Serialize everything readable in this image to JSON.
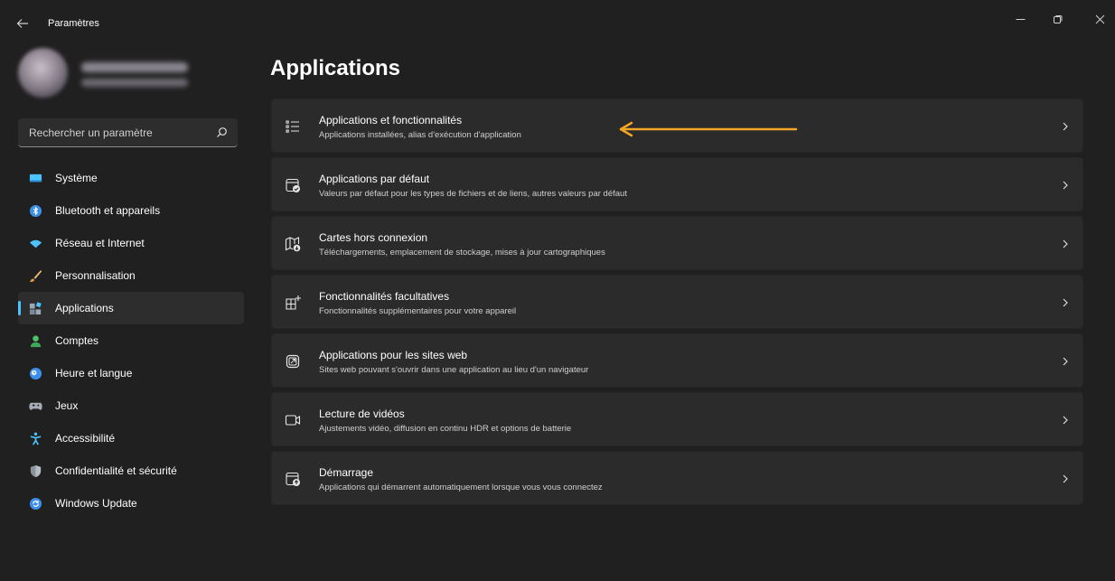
{
  "window": {
    "title": "Paramètres"
  },
  "search": {
    "placeholder": "Rechercher un paramètre"
  },
  "sidebar": {
    "items": [
      {
        "label": "Système",
        "icon": "monitor-icon"
      },
      {
        "label": "Bluetooth et appareils",
        "icon": "bluetooth-icon"
      },
      {
        "label": "Réseau et Internet",
        "icon": "wifi-icon"
      },
      {
        "label": "Personnalisation",
        "icon": "brush-icon"
      },
      {
        "label": "Applications",
        "icon": "apps-icon",
        "active": true
      },
      {
        "label": "Comptes",
        "icon": "person-icon"
      },
      {
        "label": "Heure et langue",
        "icon": "clock-globe-icon"
      },
      {
        "label": "Jeux",
        "icon": "gamepad-icon"
      },
      {
        "label": "Accessibilité",
        "icon": "accessibility-icon"
      },
      {
        "label": "Confidentialité et sécurité",
        "icon": "shield-icon"
      },
      {
        "label": "Windows Update",
        "icon": "update-icon"
      }
    ]
  },
  "main": {
    "title": "Applications",
    "cards": [
      {
        "title": "Applications et fonctionnalités",
        "description": "Applications installées, alias d'exécution d'application",
        "icon": "list-icon"
      },
      {
        "title": "Applications par défaut",
        "description": "Valeurs par défaut pour les types de fichiers et de liens, autres valeurs par défaut",
        "icon": "default-apps-icon"
      },
      {
        "title": "Cartes hors connexion",
        "description": "Téléchargements, emplacement de stockage, mises à jour cartographiques",
        "icon": "map-icon"
      },
      {
        "title": "Fonctionnalités facultatives",
        "description": "Fonctionnalités supplémentaires pour votre appareil",
        "icon": "grid-add-icon"
      },
      {
        "title": "Applications pour les sites web",
        "description": "Sites web pouvant s'ouvrir dans une application au lieu d'un navigateur",
        "icon": "open-external-icon"
      },
      {
        "title": "Lecture de vidéos",
        "description": "Ajustements vidéo, diffusion en continu HDR et options de batterie",
        "icon": "video-icon"
      },
      {
        "title": "Démarrage",
        "description": "Applications qui démarrent automatiquement lorsque vous vous connectez",
        "icon": "startup-icon"
      }
    ]
  },
  "colors": {
    "background": "#202020",
    "card": "#2b2b2b",
    "accent": "#4cc2ff",
    "annotation_arrow": "#f5a623"
  }
}
